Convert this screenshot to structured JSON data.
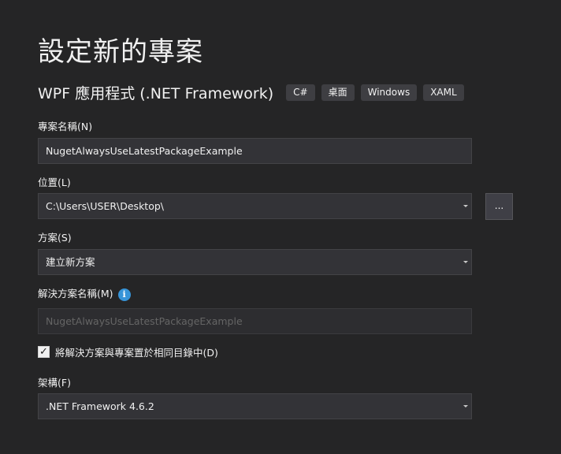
{
  "header": {
    "title": "設定新的專案",
    "project_type": "WPF 應用程式 (.NET Framework)",
    "tags": [
      "C#",
      "桌面",
      "Windows",
      "XAML"
    ]
  },
  "form": {
    "project_name": {
      "label": "專案名稱(N)",
      "value": "NugetAlwaysUseLatestPackageExample"
    },
    "location": {
      "label": "位置(L)",
      "value": "C:\\Users\\USER\\Desktop\\",
      "browse_label": "..."
    },
    "solution": {
      "label": "方案(S)",
      "value": "建立新方案"
    },
    "solution_name": {
      "label": "解決方案名稱(M)",
      "info_icon": "i",
      "value": "NugetAlwaysUseLatestPackageExample"
    },
    "same_directory": {
      "checked": true,
      "check_glyph": "✓",
      "label": "將解決方案與專案置於相同目錄中(D)"
    },
    "framework": {
      "label": "架構(F)",
      "value": ".NET Framework 4.6.2"
    }
  },
  "icons": {
    "info": "info-icon",
    "dropdown": "chevron-down-icon",
    "checkmark": "checkmark-icon"
  },
  "colors": {
    "background": "#252526",
    "field_background": "#333337",
    "accent_info": "#3794d8"
  }
}
